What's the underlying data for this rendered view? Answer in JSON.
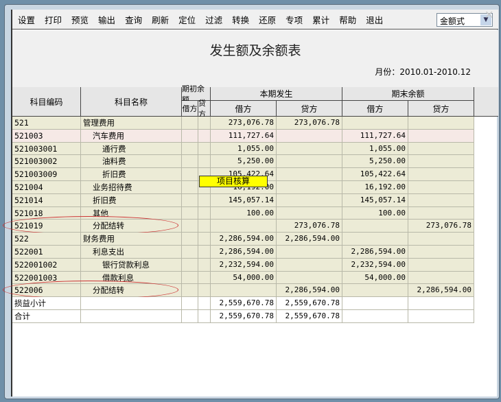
{
  "toolbar": {
    "items": [
      "设置",
      "打印",
      "预览",
      "输出",
      "查询",
      "刷新",
      "定位",
      "过滤",
      "转换",
      "还原",
      "专项",
      "累计",
      "帮助",
      "退出"
    ],
    "mode_select": "金额式"
  },
  "report": {
    "title": "发生额及余额表",
    "month": "月份：2010.01-2010.12"
  },
  "headers": {
    "code": "科目编码",
    "name": "科目名称",
    "opening": "期初余额",
    "opening_debit": "借方",
    "opening_credit": "贷方",
    "current": "本期发生",
    "current_debit": "借方",
    "current_credit": "贷方",
    "closing": "期末余额",
    "closing_debit": "借方",
    "closing_credit": "贷方"
  },
  "rows": [
    {
      "code": "521",
      "name": "管理费用",
      "level": 0,
      "cd": "273,076.78",
      "cc": "273,076.78",
      "ed": "",
      "ec": ""
    },
    {
      "code": "521003",
      "name": "汽车费用",
      "level": 1,
      "cd": "111,727.64",
      "cc": "",
      "ed": "111,727.64",
      "ec": "",
      "highlight": true
    },
    {
      "code": "521003001",
      "name": "通行费",
      "level": 2,
      "cd": "1,055.00",
      "cc": "",
      "ed": "1,055.00",
      "ec": ""
    },
    {
      "code": "521003002",
      "name": "油料费",
      "level": 2,
      "cd": "5,250.00",
      "cc": "",
      "ed": "5,250.00",
      "ec": ""
    },
    {
      "code": "521003009",
      "name": "折旧费",
      "level": 2,
      "cd": "105,422.64",
      "cc": "",
      "ed": "105,422.64",
      "ec": ""
    },
    {
      "code": "521004",
      "name": "业务招待费",
      "level": 1,
      "cd": "16,192.00",
      "cc": "",
      "ed": "16,192.00",
      "ec": ""
    },
    {
      "code": "521014",
      "name": "折旧费",
      "level": 1,
      "cd": "145,057.14",
      "cc": "",
      "ed": "145,057.14",
      "ec": ""
    },
    {
      "code": "521018",
      "name": "其他",
      "level": 1,
      "cd": "100.00",
      "cc": "",
      "ed": "100.00",
      "ec": ""
    },
    {
      "code": "521019",
      "name": "分配结转",
      "level": 1,
      "cd": "",
      "cc": "273,076.78",
      "ed": "",
      "ec": "273,076.78",
      "circled": true
    },
    {
      "code": "522",
      "name": "财务费用",
      "level": 0,
      "cd": "2,286,594.00",
      "cc": "2,286,594.00",
      "ed": "",
      "ec": ""
    },
    {
      "code": "522001",
      "name": "利息支出",
      "level": 1,
      "cd": "2,286,594.00",
      "cc": "",
      "ed": "2,286,594.00",
      "ec": ""
    },
    {
      "code": "522001002",
      "name": "银行贷款利息",
      "level": 2,
      "cd": "2,232,594.00",
      "cc": "",
      "ed": "2,232,594.00",
      "ec": ""
    },
    {
      "code": "522001003",
      "name": "借款利息",
      "level": 2,
      "cd": "54,000.00",
      "cc": "",
      "ed": "54,000.00",
      "ec": ""
    },
    {
      "code": "522006",
      "name": "分配结转",
      "level": 1,
      "cd": "",
      "cc": "2,286,594.00",
      "ed": "",
      "ec": "2,286,594.00",
      "circled": true
    },
    {
      "code": "损益小计",
      "name": "",
      "level": 0,
      "cd": "2,559,670.78",
      "cc": "2,559,670.78",
      "ed": "",
      "ec": "",
      "total": true
    },
    {
      "code": "合计",
      "name": "",
      "level": 0,
      "cd": "2,559,670.78",
      "cc": "2,559,670.78",
      "ed": "",
      "ec": "",
      "total": true
    }
  ],
  "tooltip": "项目核算",
  "colors": {
    "row_bg": "#ecebd6",
    "highlight_bg": "#f6e9e6",
    "circle": "#cc3333",
    "tooltip_bg": "#ffff00"
  }
}
